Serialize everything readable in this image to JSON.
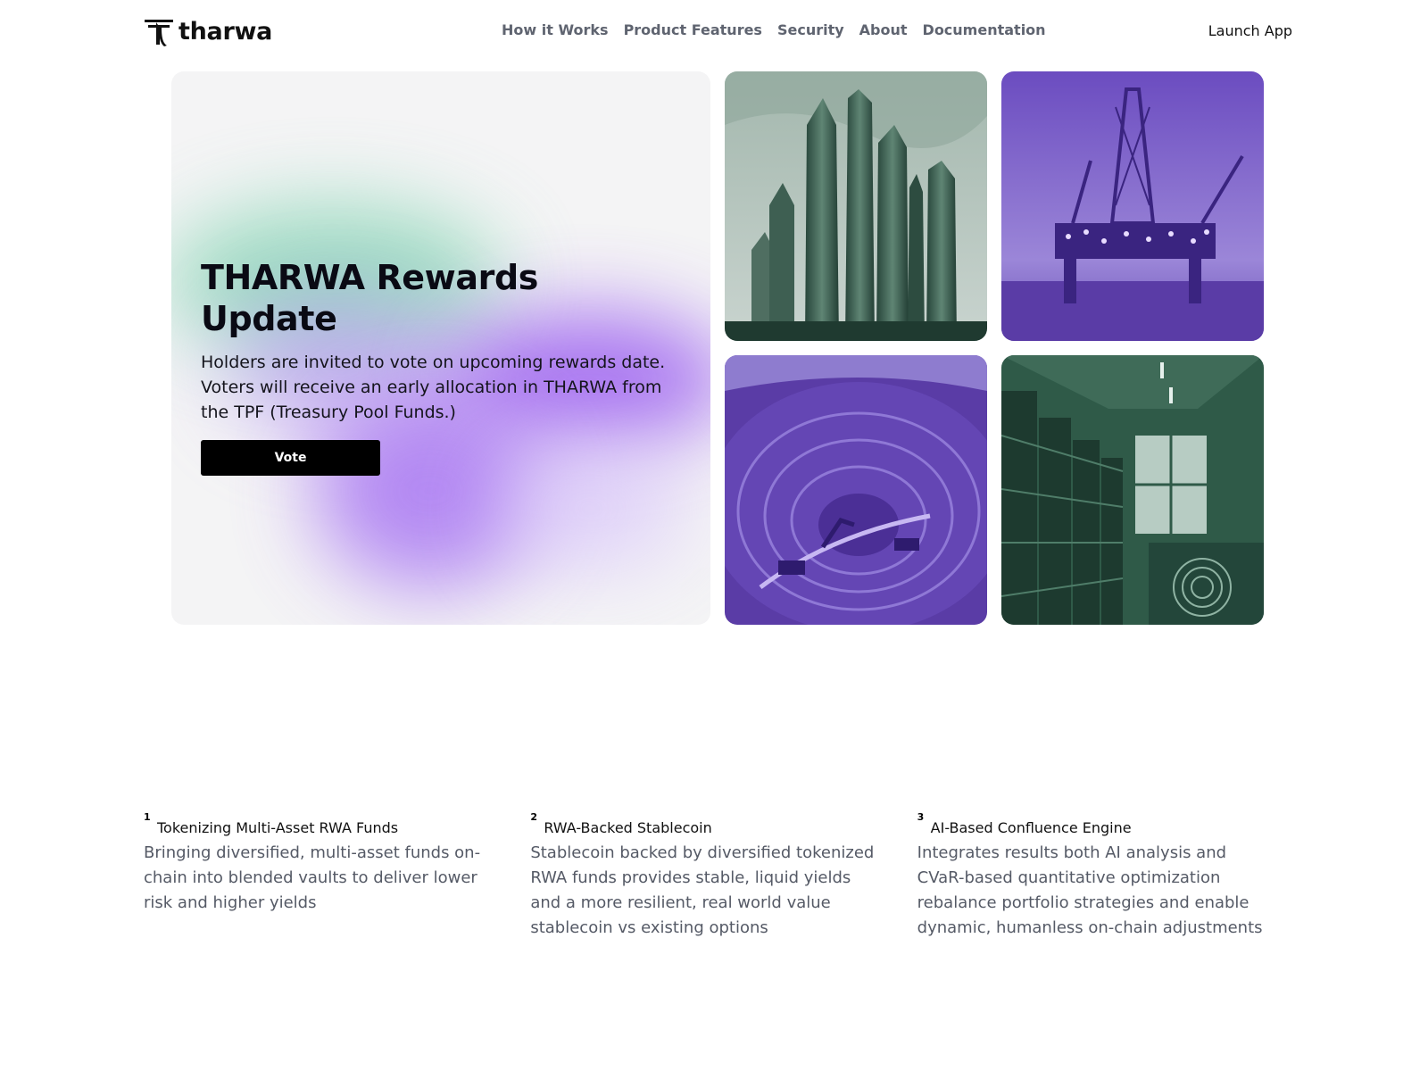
{
  "brand": {
    "name": "tharwa",
    "logo_icon": "tharwa-logo-icon"
  },
  "nav": {
    "links": [
      "How it Works",
      "Product Features",
      "Security",
      "About",
      "Documentation"
    ],
    "launch_label": "Launch App"
  },
  "hero": {
    "title": "THARWA Rewards Update",
    "body": "Holders are invited to vote on upcoming rewards date. Voters will receive an early allocation in THARWA from the TPF (Treasury Pool Funds.)",
    "button_label": "Vote",
    "colors": {
      "green": "#7fd3b0",
      "purple": "#9a5cf0",
      "button": "#000000"
    }
  },
  "tiles": [
    {
      "icon": "skyscrapers-image",
      "tint": "#3f6b55"
    },
    {
      "icon": "oil-rig-image",
      "tint": "#5a3ca6"
    },
    {
      "icon": "open-pit-mine-image",
      "tint": "#5a3ca6"
    },
    {
      "icon": "mining-server-room-image",
      "tint": "#2f5a48"
    }
  ],
  "features": [
    {
      "number": "1",
      "title": "Tokenizing Multi-Asset RWA Funds",
      "description": "Bringing diversified, multi-asset funds on-chain into blended vaults to deliver lower risk and higher yields"
    },
    {
      "number": "2",
      "title": "RWA-Backed Stablecoin",
      "description": "Stablecoin backed by diversified tokenized RWA funds provides stable, liquid yields and a more resilient, real world value stablecoin vs existing options"
    },
    {
      "number": "3",
      "title": "AI-Based Confluence Engine",
      "description": "Integrates results both AI analysis and CVaR-based quantitative optimization rebalance portfolio strategies and enable dynamic, humanless on-chain adjustments"
    }
  ]
}
